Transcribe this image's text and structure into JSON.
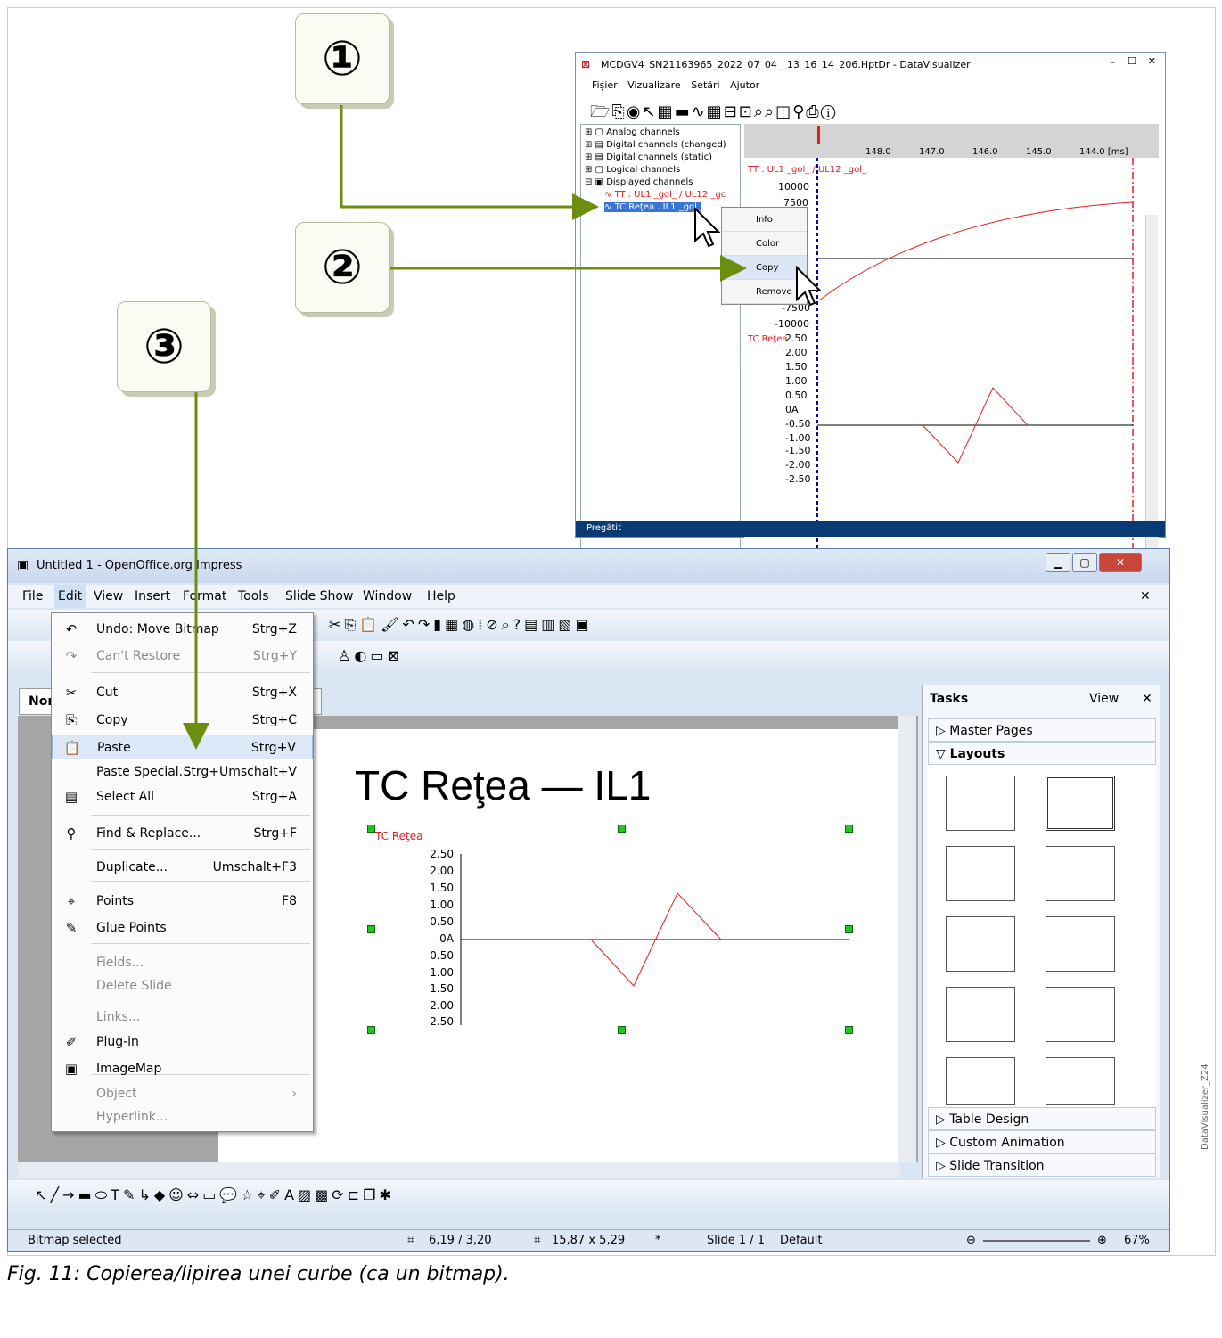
{
  "callouts": [
    "①",
    "②",
    "③"
  ],
  "dv": {
    "title": "MCDGV4_SN21163965_2022_07_04__13_16_14_206.HptDr - DataVisualizer",
    "menu": [
      "Fișier",
      "Vizualizare",
      "Setări",
      "Ajutor"
    ],
    "tree": [
      "Analog channels",
      "Digital channels (changed)",
      "Digital channels (static)",
      "Logical channels",
      "Displayed channels",
      "TT . UL1 _gol_ / UL12 _gc",
      "TC Reţea . IL1 _gol_"
    ],
    "axis_ticks": [
      "148.0",
      "147.0",
      "146.0",
      "145.0",
      "144.0 [ms]"
    ],
    "chart1_label": "TT . UL1 _gol_ / UL12 _gol_",
    "chart1_ticks": [
      "10000",
      "7500",
      "-7500",
      "-10000"
    ],
    "chart2_label": "TC Reţea",
    "chart2_ticks": [
      "2.50",
      "2.00",
      "1.50",
      "1.00",
      "0.50",
      "0A",
      "-0.50",
      "-1.00",
      "-1.50",
      "-2.00",
      "-2.50"
    ],
    "context_menu": [
      "Info",
      "Color",
      "Copy",
      "Remove"
    ],
    "status": "Pregătit"
  },
  "imp": {
    "title": "Untitled 1 - OpenOffice.org Impress",
    "menu": [
      "File",
      "Edit",
      "View",
      "Insert",
      "Format",
      "Tools",
      "Slide Show",
      "Window",
      "Help"
    ],
    "edit_menu": [
      {
        "label": "Undo: Move Bitmap",
        "shortcut": "Strg+Z",
        "icon": "undo-icon",
        "disabled": false
      },
      {
        "label": "Can't Restore",
        "shortcut": "Strg+Y",
        "icon": "redo-icon",
        "disabled": true
      },
      {
        "label": "Cut",
        "shortcut": "Strg+X",
        "icon": "scissors-icon",
        "disabled": false
      },
      {
        "label": "Copy",
        "shortcut": "Strg+C",
        "icon": "copy-icon",
        "disabled": false
      },
      {
        "label": "Paste",
        "shortcut": "Strg+V",
        "icon": "paste-icon",
        "disabled": false
      },
      {
        "label": "Paste Special...",
        "shortcut": "Strg+Umschalt+V",
        "icon": "",
        "disabled": false
      },
      {
        "label": "Select All",
        "shortcut": "Strg+A",
        "icon": "select-all-icon",
        "disabled": false
      },
      {
        "label": "Find & Replace...",
        "shortcut": "Strg+F",
        "icon": "binoculars-icon",
        "disabled": false
      },
      {
        "label": "Duplicate...",
        "shortcut": "Umschalt+F3",
        "icon": "",
        "disabled": false
      },
      {
        "label": "Points",
        "shortcut": "F8",
        "icon": "points-icon",
        "disabled": false
      },
      {
        "label": "Glue Points",
        "shortcut": "",
        "icon": "glue-icon",
        "disabled": false
      },
      {
        "label": "Fields...",
        "shortcut": "",
        "icon": "",
        "disabled": true
      },
      {
        "label": "Delete Slide",
        "shortcut": "",
        "icon": "",
        "disabled": true
      },
      {
        "label": "Links...",
        "shortcut": "",
        "icon": "",
        "disabled": true
      },
      {
        "label": "Plug-in",
        "shortcut": "",
        "icon": "plugin-icon",
        "disabled": false
      },
      {
        "label": "ImageMap",
        "shortcut": "",
        "icon": "imagemap-icon",
        "disabled": false
      },
      {
        "label": "Object",
        "shortcut": "",
        "icon": "",
        "disabled": true
      },
      {
        "label": "Hyperlink...",
        "shortcut": "",
        "icon": "",
        "disabled": true
      }
    ],
    "tab_partial": "Nor",
    "slide_title": "TC Reţea — IL1",
    "slide_chart_label": "TC Reţea",
    "slide_ticks": [
      "2.50",
      "2.00",
      "1.50",
      "1.00",
      "0.50",
      "0A",
      "-0.50",
      "-1.00",
      "-1.50",
      "-2.00",
      "-2.50"
    ],
    "tasks": {
      "title": "Tasks",
      "view": "View",
      "panels": [
        "Master Pages",
        "Layouts",
        "Table Design",
        "Custom Animation",
        "Slide Transition"
      ]
    },
    "status": {
      "left": "Bitmap selected",
      "pos": "6,19 / 3,20",
      "size": "15,87 x 5,29",
      "mod": "*",
      "slide": "Slide 1 / 1",
      "master": "Default",
      "zoom": "67%"
    }
  },
  "caption": "Fig. 11:     Copierea/lipirea unei curbe (ca un bitmap).",
  "side_label": "DataVisualizer_Z24",
  "colors": {
    "arrow": "#6b8e0e",
    "accent_red": "#e02020",
    "dv_status": "#0a3a72"
  }
}
